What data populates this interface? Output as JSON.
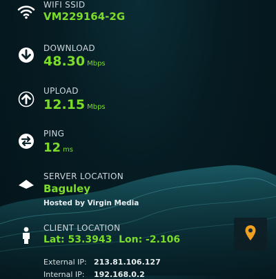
{
  "colors": {
    "accent": "#7bdc2c",
    "label": "#cfd8dc",
    "pin": "#f0a020"
  },
  "wifi": {
    "label": "WIFI SSID",
    "value": "VM229164-2G",
    "icon": "wifi-icon"
  },
  "download": {
    "label": "DOWNLOAD",
    "value": "48.30",
    "unit": "Mbps",
    "icon": "download-arrow-icon"
  },
  "upload": {
    "label": "UPLOAD",
    "value": "12.15",
    "unit": "Mbps",
    "icon": "upload-arrow-icon"
  },
  "ping": {
    "label": "PING",
    "value": "12",
    "unit": "ms",
    "icon": "ping-arrows-icon"
  },
  "server": {
    "label": "SERVER LOCATION",
    "value": "Baguley",
    "hosted": "Hosted by Virgin Media",
    "icon": "server-triangle-icon"
  },
  "client": {
    "label": "CLIENT LOCATION",
    "lat_label": "Lat:",
    "lat": "53.3943",
    "lon_label": "Lon:",
    "lon": "-2.106",
    "icon": "person-icon"
  },
  "ips": [
    {
      "label": "External IP:",
      "value": "213.81.106.127"
    },
    {
      "label": "Internal IP:",
      "value": "192.168.0.2"
    }
  ],
  "map_button": {
    "icon": "map-pin-icon"
  }
}
